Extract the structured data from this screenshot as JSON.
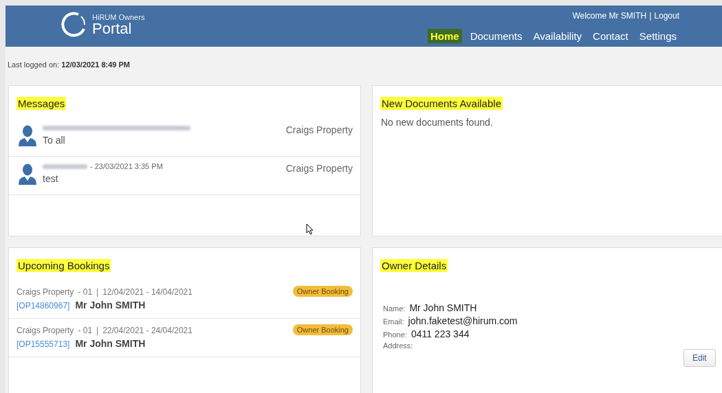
{
  "header": {
    "logo_small": "HiRUM Owners",
    "logo_large": "Portal",
    "welcome": "Welcome Mr SMITH",
    "separator": "|",
    "logout": "Logout",
    "nav": [
      {
        "label": "Home",
        "selected": true
      },
      {
        "label": "Documents",
        "selected": false
      },
      {
        "label": "Availability",
        "selected": false
      },
      {
        "label": "Contact",
        "selected": false
      },
      {
        "label": "Settings",
        "selected": false
      }
    ]
  },
  "last_logged": {
    "label": "Last logged on:",
    "value": "12/03/2021 8:49 PM"
  },
  "messages": {
    "title": "Messages",
    "highlighted": true,
    "items": [
      {
        "redacted": true,
        "text": "To all",
        "property": "Craigs Property"
      },
      {
        "redacted": true,
        "time": "- 23/03/2021 3:35 PM",
        "text": "test",
        "property": "Craigs Property"
      }
    ]
  },
  "documents": {
    "title": "New Documents Available",
    "highlighted": true,
    "empty_text": "No new documents found."
  },
  "bookings": {
    "title": "Upcoming Bookings",
    "highlighted": true,
    "items": [
      {
        "property": "Craigs Property",
        "unit": "- 01",
        "separator": "|",
        "dates": "12/04/2021 - 14/04/2021",
        "reference": "[OP14860967]",
        "guest": "Mr John SMITH",
        "badge": "Owner Booking"
      },
      {
        "property": "Craigs Property",
        "unit": "- 01",
        "separator": "|",
        "dates": "22/04/2021 - 24/04/2021",
        "reference": "[OP15555713]",
        "guest": "Mr John SMITH",
        "badge": "Owner Booking"
      }
    ]
  },
  "owner": {
    "title": "Owner Details",
    "highlighted": true,
    "fields": [
      {
        "label": "Name:",
        "value": "Mr John SMITH"
      },
      {
        "label": "Email:",
        "value": "john.faketest@hirum.com"
      },
      {
        "label": "Phone:",
        "value": "0411 223 344"
      },
      {
        "label": "Address:"
      }
    ],
    "edit_button": "Edit"
  }
}
